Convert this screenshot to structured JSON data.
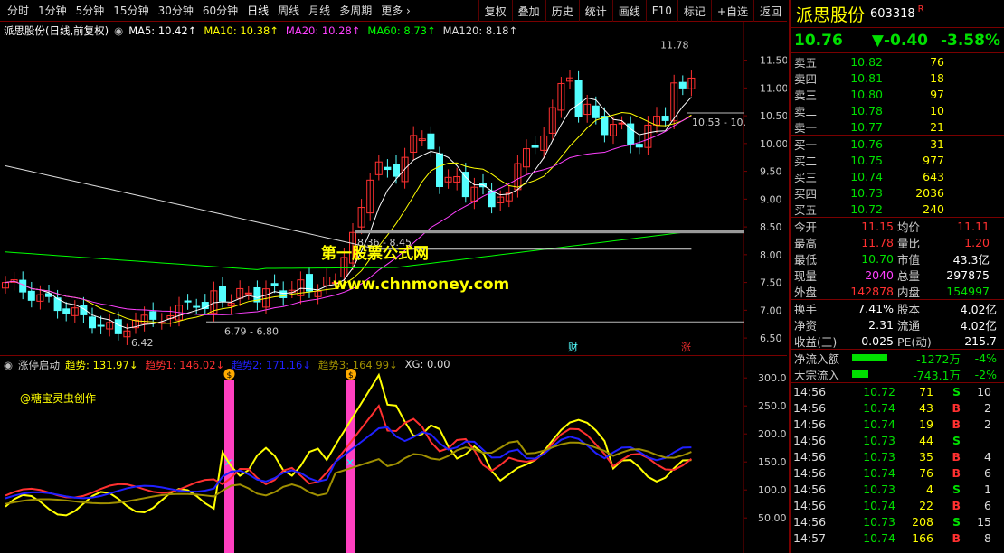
{
  "toolbar": {
    "periods": [
      "分时",
      "1分钟",
      "5分钟",
      "15分钟",
      "30分钟",
      "60分钟",
      "日线",
      "周线",
      "月线",
      "多周期",
      "更多 ›"
    ],
    "active_period": "日线",
    "actions": [
      "复权",
      "叠加",
      "历史",
      "统计",
      "画线",
      "F10",
      "标记",
      "+自选",
      "返回"
    ]
  },
  "main_chart": {
    "title": "派思股份(日线,前复权)",
    "ma_legend": [
      {
        "label": "MA5: 10.42↑",
        "color": "#ffffff"
      },
      {
        "label": "MA10: 10.38↑",
        "color": "#ffff00"
      },
      {
        "label": "MA20: 10.28↑",
        "color": "#ff40ff"
      },
      {
        "label": "MA60: 8.73↑",
        "color": "#00ff00"
      },
      {
        "label": "MA120: 8.18↑",
        "color": "#dddddd"
      }
    ],
    "price_axis": [
      "11.50",
      "11.00",
      "10.50",
      "10.00",
      "9.50",
      "9.00",
      "8.50",
      "8.00",
      "7.50",
      "7.00",
      "6.50"
    ],
    "annotations": {
      "high": "11.78",
      "low": "6.42",
      "range1": "6.79 - 6.80",
      "range2": "8.36 - 8.45",
      "range3": "10.53 - 10.",
      "marker_cai": "财",
      "marker_zhang": "涨"
    },
    "watermark": [
      "第一股票公式网",
      "www.chnmoney.com"
    ]
  },
  "indicator": {
    "name": "涨停启动",
    "legend": [
      {
        "label": "趋势: 131.97↓",
        "color": "#ffff00"
      },
      {
        "label": "趋势1: 146.02↓",
        "color": "#ff3030"
      },
      {
        "label": "趋势2: 171.16↓",
        "color": "#2020ff"
      },
      {
        "label": "趋势3: 164.99↓",
        "color": "#a09000"
      },
      {
        "label": "XG: 0.00",
        "color": "#dddddd"
      }
    ],
    "axis": [
      "300.0",
      "250.0",
      "200.0",
      "150.0",
      "100.0",
      "50.00"
    ],
    "credit": "@糖宝灵虫创作",
    "badge_icon": "$"
  },
  "quote": {
    "name": "派思股份",
    "code": "603318",
    "margin_flag": "R",
    "price": "10.76",
    "change": "▼-0.40",
    "change_pct": "-3.58%",
    "asks": [
      {
        "label": "卖五",
        "price": "10.82",
        "vol": "76"
      },
      {
        "label": "卖四",
        "price": "10.81",
        "vol": "18"
      },
      {
        "label": "卖三",
        "price": "10.80",
        "vol": "97"
      },
      {
        "label": "卖二",
        "price": "10.78",
        "vol": "10"
      },
      {
        "label": "卖一",
        "price": "10.77",
        "vol": "21"
      }
    ],
    "bids": [
      {
        "label": "买一",
        "price": "10.76",
        "vol": "31"
      },
      {
        "label": "买二",
        "price": "10.75",
        "vol": "977"
      },
      {
        "label": "买三",
        "price": "10.74",
        "vol": "643"
      },
      {
        "label": "买四",
        "price": "10.73",
        "vol": "2036"
      },
      {
        "label": "买五",
        "price": "10.72",
        "vol": "240"
      }
    ],
    "stats": [
      {
        "l1": "今开",
        "v1": "11.15",
        "c1": "red",
        "l2": "均价",
        "v2": "11.11",
        "c2": "red"
      },
      {
        "l1": "最高",
        "v1": "11.78",
        "c1": "red",
        "l2": "量比",
        "v2": "1.20",
        "c2": "red"
      },
      {
        "l1": "最低",
        "v1": "10.70",
        "c1": "green",
        "l2": "市值",
        "v2": "43.3亿",
        "c2": "white"
      },
      {
        "l1": "现量",
        "v1": "2040",
        "c1": "mag",
        "l2": "总量",
        "v2": "297875",
        "c2": "white"
      },
      {
        "l1": "外盘",
        "v1": "142878",
        "c1": "red",
        "l2": "内盘",
        "v2": "154997",
        "c2": "green"
      }
    ],
    "stats2": [
      {
        "l1": "换手",
        "v1": "7.41%",
        "l2": "股本",
        "v2": "4.02亿"
      },
      {
        "l1": "净资",
        "v1": "2.31",
        "l2": "流通",
        "v2": "4.02亿"
      },
      {
        "l1": "收益(三)",
        "v1": "0.025",
        "l2": "PE(动)",
        "v2": "215.7"
      }
    ],
    "flows": [
      {
        "label": "净流入额",
        "value": "-1272万",
        "pct": "-4%",
        "bar_fraction": 0.7
      },
      {
        "label": "大宗流入",
        "value": "-743.1万",
        "pct": "-2%",
        "bar_fraction": 0.32
      }
    ],
    "ticks": [
      {
        "time": "14:56",
        "price": "10.72",
        "vol": "71",
        "side": "S",
        "n": "10"
      },
      {
        "time": "14:56",
        "price": "10.74",
        "vol": "43",
        "side": "B",
        "n": "2"
      },
      {
        "time": "14:56",
        "price": "10.74",
        "vol": "19",
        "side": "B",
        "n": "2"
      },
      {
        "time": "14:56",
        "price": "10.73",
        "vol": "44",
        "side": "S",
        "n": ""
      },
      {
        "time": "14:56",
        "price": "10.73",
        "vol": "35",
        "side": "B",
        "n": "4"
      },
      {
        "time": "14:56",
        "price": "10.74",
        "vol": "76",
        "side": "B",
        "n": "6"
      },
      {
        "time": "14:56",
        "price": "10.73",
        "vol": "4",
        "side": "S",
        "n": "1"
      },
      {
        "time": "14:56",
        "price": "10.74",
        "vol": "22",
        "side": "B",
        "n": "6"
      },
      {
        "time": "14:56",
        "price": "10.73",
        "vol": "208",
        "side": "S",
        "n": "15"
      },
      {
        "time": "14:57",
        "price": "10.74",
        "vol": "166",
        "side": "B",
        "n": "8"
      }
    ]
  },
  "colors": {
    "up": "#ff3030",
    "down": "#54ffff",
    "frame": "#7a0000"
  }
}
